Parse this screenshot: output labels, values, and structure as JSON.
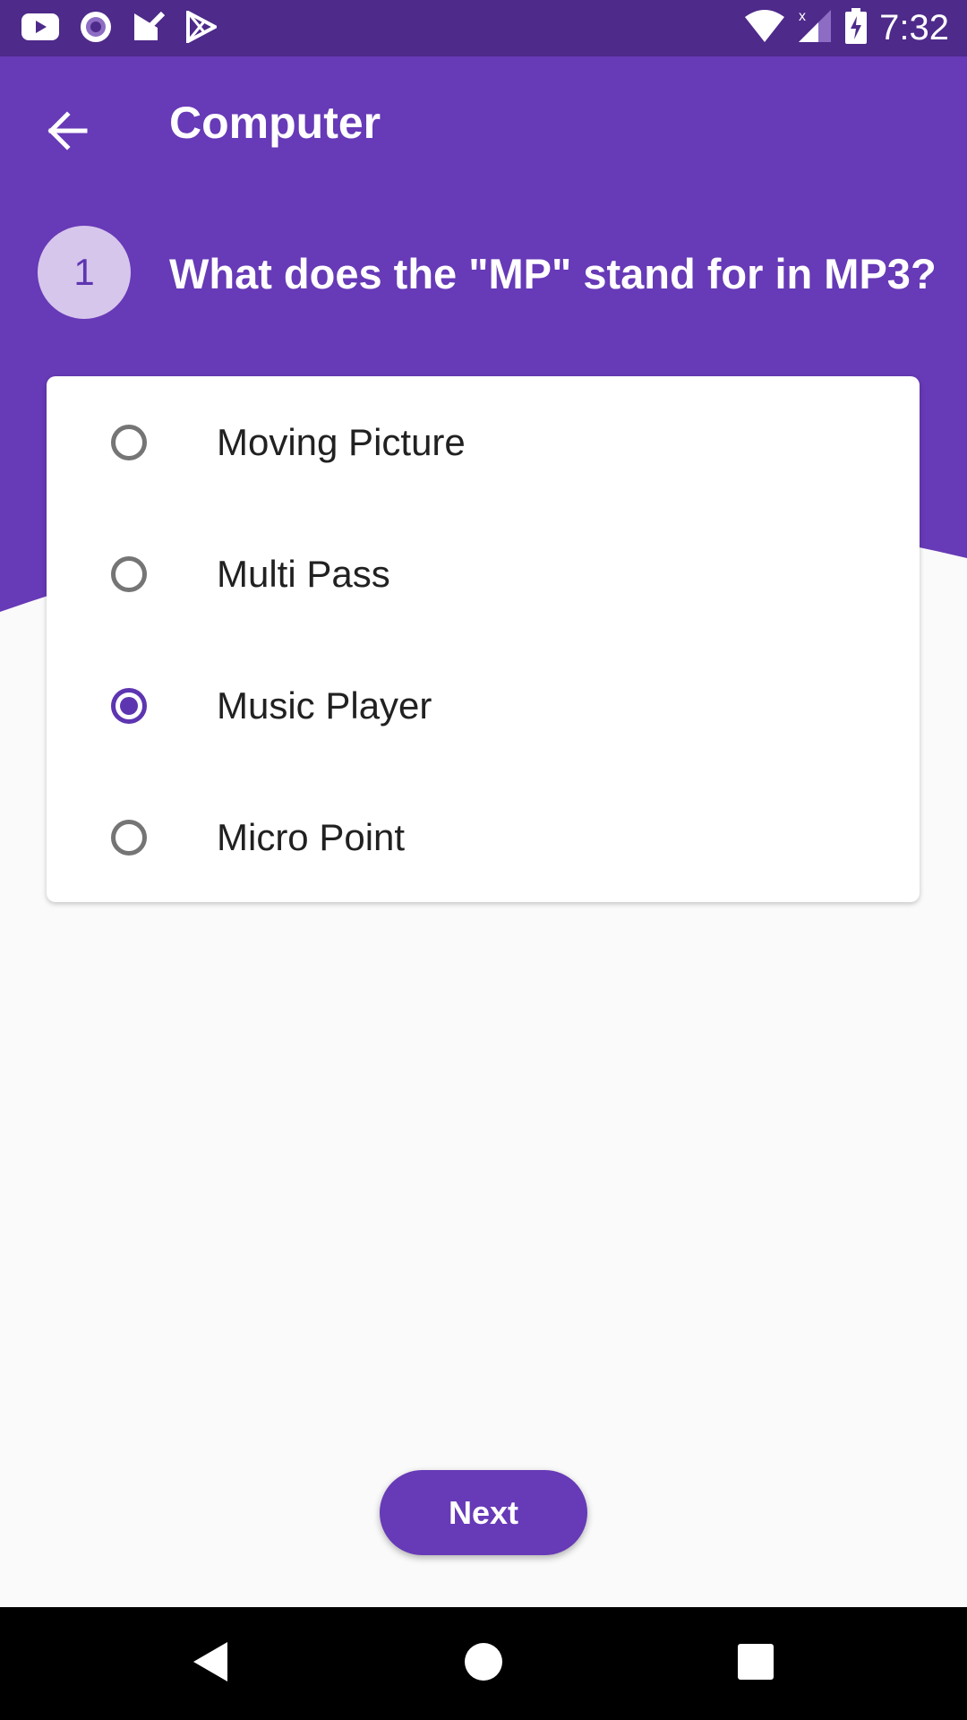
{
  "status_bar": {
    "time": "7:32",
    "left_icons": [
      "youtube-icon",
      "podcast-icon",
      "tasks-icon",
      "play-store-icon"
    ],
    "right_icons": [
      "wifi-icon",
      "signal-icon",
      "battery-charging-icon"
    ]
  },
  "toolbar": {
    "title": "Computer",
    "back_icon": "arrow-back-icon"
  },
  "question": {
    "number": "1",
    "text": "What does the \"MP\" stand for in MP3?"
  },
  "options": [
    {
      "label": "Moving Picture",
      "selected": false
    },
    {
      "label": "Multi Pass",
      "selected": false
    },
    {
      "label": "Music Player",
      "selected": true
    },
    {
      "label": "Micro Point",
      "selected": false
    }
  ],
  "next_button": {
    "label": "Next"
  },
  "nav_bar": {
    "icons": [
      "back-triangle-icon",
      "home-circle-icon",
      "recents-square-icon"
    ]
  },
  "colors": {
    "primary": "#673ab7",
    "status_bar": "#4e2a8a",
    "accent": "#5e35b1",
    "background": "#fafafa"
  }
}
